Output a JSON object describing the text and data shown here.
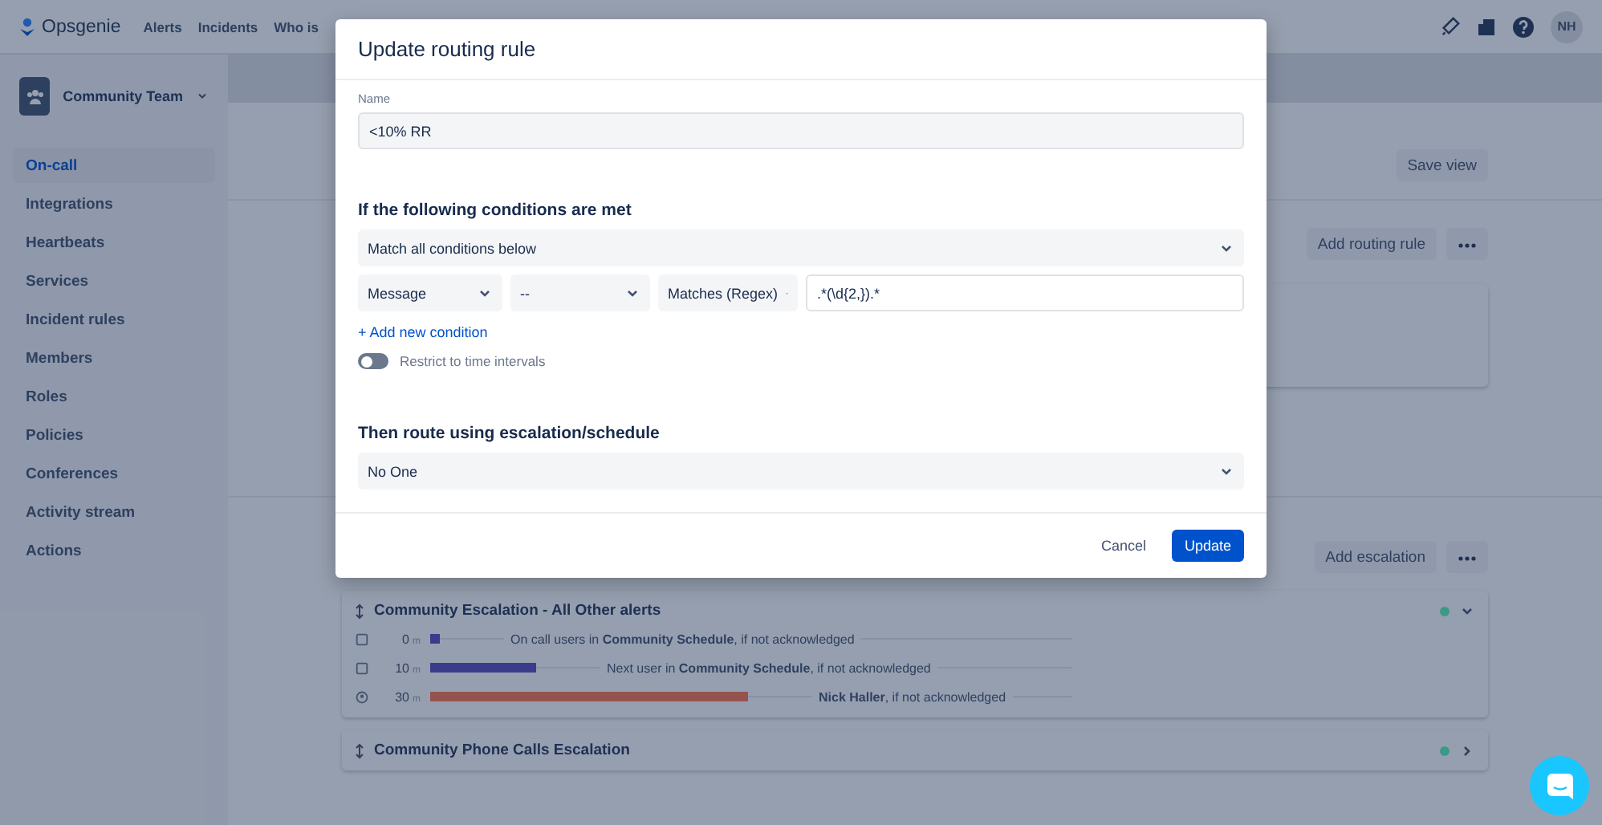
{
  "nav": {
    "logo": "Opsgenie",
    "items": [
      "Alerts",
      "Incidents",
      "Who is"
    ],
    "avatar": "NH"
  },
  "sidebar": {
    "team": "Community Team",
    "items": [
      {
        "label": "On-call",
        "selected": true
      },
      {
        "label": "Integrations",
        "selected": false
      },
      {
        "label": "Heartbeats",
        "selected": false
      },
      {
        "label": "Services",
        "selected": false
      },
      {
        "label": "Incident rules",
        "selected": false
      },
      {
        "label": "Members",
        "selected": false
      },
      {
        "label": "Roles",
        "selected": false
      },
      {
        "label": "Policies",
        "selected": false
      },
      {
        "label": "Conferences",
        "selected": false
      },
      {
        "label": "Activity stream",
        "selected": false
      },
      {
        "label": "Actions",
        "selected": false
      }
    ]
  },
  "main": {
    "save_view": "Save view",
    "add_routing_rule": "Add routing rule",
    "add_escalation": "Add escalation",
    "escalations": [
      {
        "title": "Community Escalation - All Other alerts",
        "expanded": true,
        "color": "#3d9a87",
        "steps": [
          {
            "kind": "schedule",
            "minutes": "0",
            "unit": "m",
            "level": 0.015,
            "color": "#3c3c8c",
            "text": "On call users in **Community Schedule**, if not acknowledged"
          },
          {
            "kind": "schedule",
            "minutes": "10",
            "unit": "m",
            "level": 0.165,
            "color": "#3c3c8c",
            "text": "Next user in **Community Schedule**, if not acknowledged"
          },
          {
            "kind": "user",
            "minutes": "30",
            "unit": "m",
            "level": 0.495,
            "color": "#96544d",
            "text": "**Nick Haller**, if not acknowledged"
          }
        ]
      },
      {
        "title": "Community Phone Calls Escalation",
        "expanded": false,
        "color": "#3d9a87"
      }
    ]
  },
  "modal": {
    "title": "Update routing rule",
    "name_label": "Name",
    "name_value": "<10% RR",
    "conditions_heading": "If the following conditions are met",
    "match": "Match all conditions below",
    "condition": {
      "field": "Message",
      "operator": "--",
      "matcher": "Matches (Regex)",
      "value": ".*(\\d{2,}).*"
    },
    "add_condition": "+ Add new condition",
    "restrict": {
      "label": "Restrict to time intervals",
      "on": false
    },
    "route_heading": "Then route using escalation/schedule",
    "route": "No One",
    "cancel": "Cancel",
    "update": "Update"
  }
}
